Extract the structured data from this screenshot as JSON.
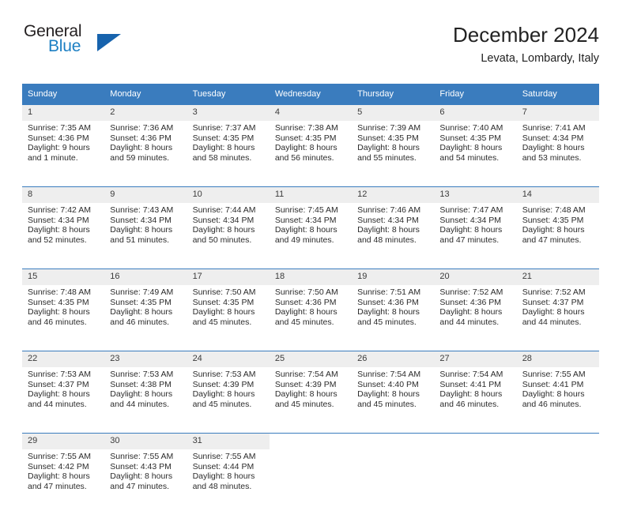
{
  "logo": {
    "word1": "General",
    "word2": "Blue",
    "triangle_color": "#1763ad",
    "blue_color": "#1c7fc3"
  },
  "header": {
    "title": "December 2024",
    "subtitle": "Levata, Lombardy, Italy"
  },
  "theme": {
    "header_bg": "#3a7cbe",
    "daynum_bg": "#eeeeee",
    "rule_color": "#3a7cbe"
  },
  "weekdays": [
    "Sunday",
    "Monday",
    "Tuesday",
    "Wednesday",
    "Thursday",
    "Friday",
    "Saturday"
  ],
  "labels": {
    "sunrise_prefix": "Sunrise: ",
    "sunset_prefix": "Sunset: ",
    "daylight_prefix": "Daylight: "
  },
  "weeks": [
    {
      "days": [
        {
          "num": "1",
          "sunrise": "Sunrise: 7:35 AM",
          "sunset": "Sunset: 4:36 PM",
          "daylight1": "Daylight: 9 hours",
          "daylight2": "and 1 minute."
        },
        {
          "num": "2",
          "sunrise": "Sunrise: 7:36 AM",
          "sunset": "Sunset: 4:36 PM",
          "daylight1": "Daylight: 8 hours",
          "daylight2": "and 59 minutes."
        },
        {
          "num": "3",
          "sunrise": "Sunrise: 7:37 AM",
          "sunset": "Sunset: 4:35 PM",
          "daylight1": "Daylight: 8 hours",
          "daylight2": "and 58 minutes."
        },
        {
          "num": "4",
          "sunrise": "Sunrise: 7:38 AM",
          "sunset": "Sunset: 4:35 PM",
          "daylight1": "Daylight: 8 hours",
          "daylight2": "and 56 minutes."
        },
        {
          "num": "5",
          "sunrise": "Sunrise: 7:39 AM",
          "sunset": "Sunset: 4:35 PM",
          "daylight1": "Daylight: 8 hours",
          "daylight2": "and 55 minutes."
        },
        {
          "num": "6",
          "sunrise": "Sunrise: 7:40 AM",
          "sunset": "Sunset: 4:35 PM",
          "daylight1": "Daylight: 8 hours",
          "daylight2": "and 54 minutes."
        },
        {
          "num": "7",
          "sunrise": "Sunrise: 7:41 AM",
          "sunset": "Sunset: 4:34 PM",
          "daylight1": "Daylight: 8 hours",
          "daylight2": "and 53 minutes."
        }
      ]
    },
    {
      "days": [
        {
          "num": "8",
          "sunrise": "Sunrise: 7:42 AM",
          "sunset": "Sunset: 4:34 PM",
          "daylight1": "Daylight: 8 hours",
          "daylight2": "and 52 minutes."
        },
        {
          "num": "9",
          "sunrise": "Sunrise: 7:43 AM",
          "sunset": "Sunset: 4:34 PM",
          "daylight1": "Daylight: 8 hours",
          "daylight2": "and 51 minutes."
        },
        {
          "num": "10",
          "sunrise": "Sunrise: 7:44 AM",
          "sunset": "Sunset: 4:34 PM",
          "daylight1": "Daylight: 8 hours",
          "daylight2": "and 50 minutes."
        },
        {
          "num": "11",
          "sunrise": "Sunrise: 7:45 AM",
          "sunset": "Sunset: 4:34 PM",
          "daylight1": "Daylight: 8 hours",
          "daylight2": "and 49 minutes."
        },
        {
          "num": "12",
          "sunrise": "Sunrise: 7:46 AM",
          "sunset": "Sunset: 4:34 PM",
          "daylight1": "Daylight: 8 hours",
          "daylight2": "and 48 minutes."
        },
        {
          "num": "13",
          "sunrise": "Sunrise: 7:47 AM",
          "sunset": "Sunset: 4:34 PM",
          "daylight1": "Daylight: 8 hours",
          "daylight2": "and 47 minutes."
        },
        {
          "num": "14",
          "sunrise": "Sunrise: 7:48 AM",
          "sunset": "Sunset: 4:35 PM",
          "daylight1": "Daylight: 8 hours",
          "daylight2": "and 47 minutes."
        }
      ]
    },
    {
      "days": [
        {
          "num": "15",
          "sunrise": "Sunrise: 7:48 AM",
          "sunset": "Sunset: 4:35 PM",
          "daylight1": "Daylight: 8 hours",
          "daylight2": "and 46 minutes."
        },
        {
          "num": "16",
          "sunrise": "Sunrise: 7:49 AM",
          "sunset": "Sunset: 4:35 PM",
          "daylight1": "Daylight: 8 hours",
          "daylight2": "and 46 minutes."
        },
        {
          "num": "17",
          "sunrise": "Sunrise: 7:50 AM",
          "sunset": "Sunset: 4:35 PM",
          "daylight1": "Daylight: 8 hours",
          "daylight2": "and 45 minutes."
        },
        {
          "num": "18",
          "sunrise": "Sunrise: 7:50 AM",
          "sunset": "Sunset: 4:36 PM",
          "daylight1": "Daylight: 8 hours",
          "daylight2": "and 45 minutes."
        },
        {
          "num": "19",
          "sunrise": "Sunrise: 7:51 AM",
          "sunset": "Sunset: 4:36 PM",
          "daylight1": "Daylight: 8 hours",
          "daylight2": "and 45 minutes."
        },
        {
          "num": "20",
          "sunrise": "Sunrise: 7:52 AM",
          "sunset": "Sunset: 4:36 PM",
          "daylight1": "Daylight: 8 hours",
          "daylight2": "and 44 minutes."
        },
        {
          "num": "21",
          "sunrise": "Sunrise: 7:52 AM",
          "sunset": "Sunset: 4:37 PM",
          "daylight1": "Daylight: 8 hours",
          "daylight2": "and 44 minutes."
        }
      ]
    },
    {
      "days": [
        {
          "num": "22",
          "sunrise": "Sunrise: 7:53 AM",
          "sunset": "Sunset: 4:37 PM",
          "daylight1": "Daylight: 8 hours",
          "daylight2": "and 44 minutes."
        },
        {
          "num": "23",
          "sunrise": "Sunrise: 7:53 AM",
          "sunset": "Sunset: 4:38 PM",
          "daylight1": "Daylight: 8 hours",
          "daylight2": "and 44 minutes."
        },
        {
          "num": "24",
          "sunrise": "Sunrise: 7:53 AM",
          "sunset": "Sunset: 4:39 PM",
          "daylight1": "Daylight: 8 hours",
          "daylight2": "and 45 minutes."
        },
        {
          "num": "25",
          "sunrise": "Sunrise: 7:54 AM",
          "sunset": "Sunset: 4:39 PM",
          "daylight1": "Daylight: 8 hours",
          "daylight2": "and 45 minutes."
        },
        {
          "num": "26",
          "sunrise": "Sunrise: 7:54 AM",
          "sunset": "Sunset: 4:40 PM",
          "daylight1": "Daylight: 8 hours",
          "daylight2": "and 45 minutes."
        },
        {
          "num": "27",
          "sunrise": "Sunrise: 7:54 AM",
          "sunset": "Sunset: 4:41 PM",
          "daylight1": "Daylight: 8 hours",
          "daylight2": "and 46 minutes."
        },
        {
          "num": "28",
          "sunrise": "Sunrise: 7:55 AM",
          "sunset": "Sunset: 4:41 PM",
          "daylight1": "Daylight: 8 hours",
          "daylight2": "and 46 minutes."
        }
      ]
    },
    {
      "days": [
        {
          "num": "29",
          "sunrise": "Sunrise: 7:55 AM",
          "sunset": "Sunset: 4:42 PM",
          "daylight1": "Daylight: 8 hours",
          "daylight2": "and 47 minutes."
        },
        {
          "num": "30",
          "sunrise": "Sunrise: 7:55 AM",
          "sunset": "Sunset: 4:43 PM",
          "daylight1": "Daylight: 8 hours",
          "daylight2": "and 47 minutes."
        },
        {
          "num": "31",
          "sunrise": "Sunrise: 7:55 AM",
          "sunset": "Sunset: 4:44 PM",
          "daylight1": "Daylight: 8 hours",
          "daylight2": "and 48 minutes."
        },
        {
          "num": "",
          "sunrise": "",
          "sunset": "",
          "daylight1": "",
          "daylight2": "",
          "empty": true
        },
        {
          "num": "",
          "sunrise": "",
          "sunset": "",
          "daylight1": "",
          "daylight2": "",
          "empty": true
        },
        {
          "num": "",
          "sunrise": "",
          "sunset": "",
          "daylight1": "",
          "daylight2": "",
          "empty": true
        },
        {
          "num": "",
          "sunrise": "",
          "sunset": "",
          "daylight1": "",
          "daylight2": "",
          "empty": true
        }
      ]
    }
  ]
}
